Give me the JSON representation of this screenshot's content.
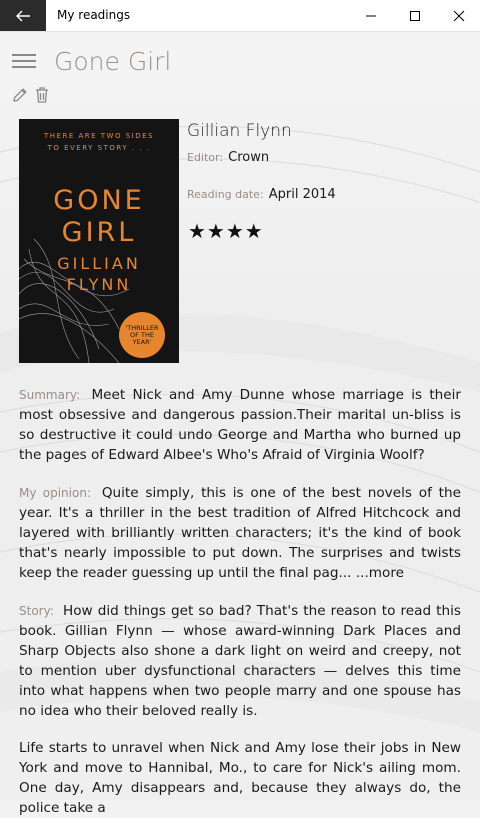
{
  "window": {
    "title": "My readings"
  },
  "header": {
    "book_title": "Gone Girl"
  },
  "cover": {
    "tagline_1": "THERE ARE TWO SIDES",
    "tagline_2": "TO EVERY STORY . . .",
    "title_line_1": "GONE",
    "title_line_2": "GIRL",
    "author_line_1": "GILLIAN",
    "author_line_2": "FLYNN",
    "badge_line_1": "'THRILLER",
    "badge_line_2": "OF THE",
    "badge_line_3": "YEAR'",
    "accent_color": "#e8862f"
  },
  "details": {
    "author": "Gillian Flynn",
    "editor_label": "Editor:",
    "editor": "Crown",
    "reading_date_label": "Reading date:",
    "reading_date": "April 2014",
    "rating_stars": "★★★★",
    "rating": 4
  },
  "sections": {
    "summary_label": "Summary:",
    "summary_text": "Meet Nick and Amy Dunne whose marriage is their most obsessive and dangerous passion.Their marital un-bliss is so destructive it could undo George and Martha who burned up the pages of Edward Albee's Who's Afraid of Virginia Woolf?",
    "opinion_label": "My opinion:",
    "opinion_text": "Quite simply, this is one of the best novels of the year. It's a thriller in the best tradition of Alfred Hitchcock and layered with brilliantly written characters; it's the kind of book that's nearly impossible to put down. The surprises and twists keep the reader guessing up until the final pag... ",
    "opinion_more": "...more",
    "story_label": "Story:",
    "story_text": "How did things get so bad? That's the reason to read this book. Gillian Flynn — whose award-winning Dark Places and Sharp Objects also shone a dark light on weird and creepy, not to mention uber dysfunctional characters — delves this time into what happens when two people marry and one spouse has no idea who their beloved really is.",
    "story_text_2": "Life starts to unravel when Nick and Amy lose their jobs in New York and move to Hannibal, Mo., to care for Nick's ailing mom. One day, Amy disappears and, because they always do, the police take a"
  },
  "icons": {
    "back": "arrow-left-icon",
    "minimize": "minimize-icon",
    "maximize": "maximize-icon",
    "close": "close-icon",
    "menu": "hamburger-icon",
    "edit": "pencil-icon",
    "delete": "trash-icon"
  }
}
